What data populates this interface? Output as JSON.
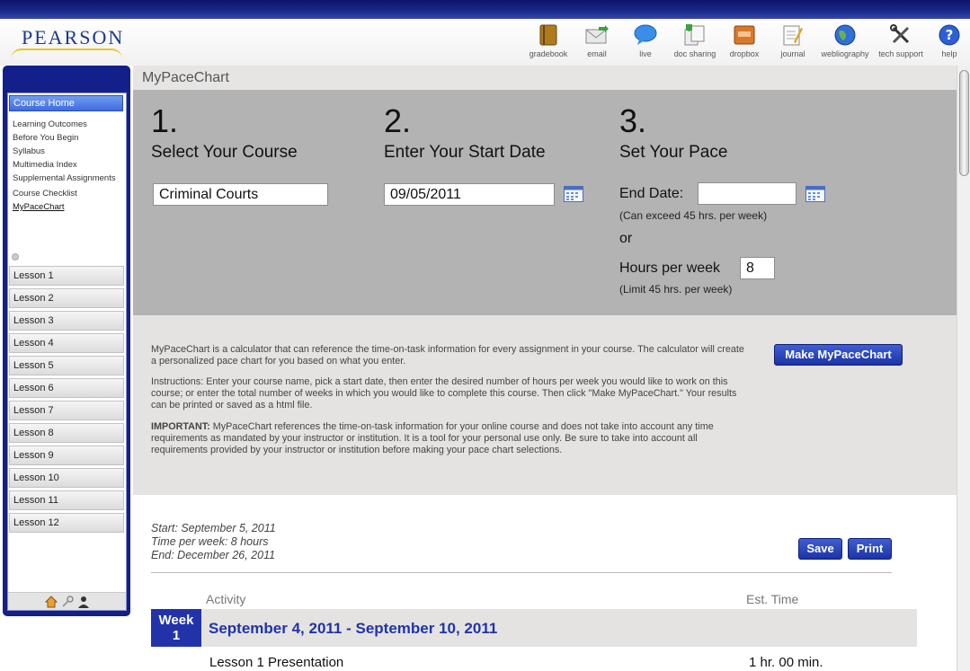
{
  "header": {
    "logo": "PEARSON",
    "tools": [
      {
        "label": "gradebook",
        "icon": "gradebook-icon"
      },
      {
        "label": "email",
        "icon": "email-icon"
      },
      {
        "label": "live",
        "icon": "live-chat-icon"
      },
      {
        "label": "doc sharing",
        "icon": "doc-sharing-icon"
      },
      {
        "label": "dropbox",
        "icon": "dropbox-icon"
      },
      {
        "label": "journal",
        "icon": "journal-icon"
      },
      {
        "label": "webliography",
        "icon": "globe-icon"
      },
      {
        "label": "tech support",
        "icon": "tools-icon"
      },
      {
        "label": "help",
        "icon": "help-icon"
      }
    ]
  },
  "sidebar": {
    "course_home": "Course Home",
    "links": [
      "Learning Outcomes",
      "Before You Begin",
      "Syllabus",
      "Multimedia Index",
      "Supplemental Assignments",
      "Course Checklist",
      "MyPaceChart"
    ],
    "lessons": [
      "Lesson 1",
      "Lesson 2",
      "Lesson 3",
      "Lesson 4",
      "Lesson 5",
      "Lesson 6",
      "Lesson 7",
      "Lesson 8",
      "Lesson 9",
      "Lesson 10",
      "Lesson 11",
      "Lesson 12"
    ]
  },
  "page": {
    "title": "MyPaceChart",
    "step1": {
      "num": "1.",
      "title": "Select Your Course",
      "value": "Criminal Courts"
    },
    "step2": {
      "num": "2.",
      "title": "Enter Your Start Date",
      "value": "09/05/2011"
    },
    "step3": {
      "num": "3.",
      "title": "Set Your Pace",
      "end_label": "End Date:",
      "end_value": "",
      "end_note": "(Can exceed 45 hrs. per week)",
      "or": "or",
      "hours_label": "Hours per week",
      "hours_value": "8",
      "hours_note": "(Limit 45 hrs. per week)"
    },
    "info": {
      "p1": "MyPaceChart is a calculator that can reference the time-on-task information for every assignment in your course. The calculator will create a personalized pace chart for you based on what you enter.",
      "p2": "Instructions: Enter your course name, pick a start date, then enter the desired number of hours per week you would like to work on this course; or enter the total number of weeks in which you would like to complete this course. Then click \"Make MyPaceChart.\" Your results can be printed or saved as a html file.",
      "p3_bold": "IMPORTANT:",
      "p3": " MyPaceChart references the time-on-task information for your online course and does not take into account any time requirements as mandated by your instructor or institution. It is a tool for your personal use only. Be sure to take into account all requirements provided by your instructor or institution before making your pace chart selections.",
      "make_button": "Make MyPaceChart"
    },
    "results": {
      "start": "Start: September 5, 2011",
      "time": "Time per week: 8 hours",
      "end": "End: December 26, 2011",
      "save": "Save",
      "print": "Print",
      "col_activity": "Activity",
      "col_time": "Est. Time",
      "week_label": "Week",
      "week_num": "1",
      "week_range": "September 4, 2011 - September 10, 2011",
      "rows": [
        {
          "activity": "Lesson 1 Presentation",
          "time": "1 hr. 00 min."
        }
      ]
    }
  }
}
